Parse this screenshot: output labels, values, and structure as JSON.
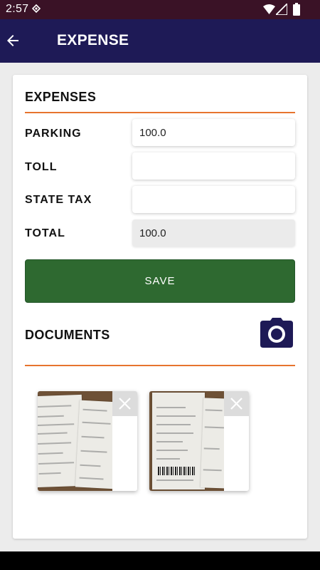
{
  "status_bar": {
    "time": "2:57"
  },
  "app_bar": {
    "title": "EXPENSE"
  },
  "expenses": {
    "title": "EXPENSES",
    "rows": [
      {
        "label": "PARKING",
        "value": "100.0"
      },
      {
        "label": "TOLL",
        "value": ""
      },
      {
        "label": "STATE TAX",
        "value": ""
      },
      {
        "label": "TOTAL",
        "value": "100.0"
      }
    ],
    "save_label": "SAVE"
  },
  "documents": {
    "title": "DOCUMENTS",
    "count": 2
  },
  "icons": [
    "back-arrow-icon",
    "camera-icon",
    "close-icon",
    "wifi-icon",
    "signal-icon",
    "battery-icon"
  ],
  "colors": {
    "app_bar": "#1e1a56",
    "status_bar": "#3a1226",
    "accent_divider": "#e7742e",
    "save_button": "#2e6930"
  }
}
